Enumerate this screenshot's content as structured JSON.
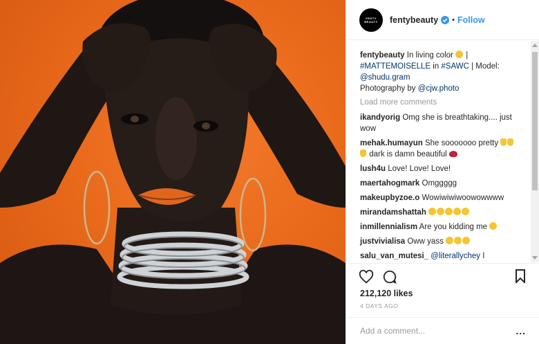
{
  "post": {
    "brand_logo_text": "FENTY BEAUTY",
    "username": "fentybeauty",
    "follow_label": "Follow",
    "caption": {
      "username": "fentybeauty",
      "text_1": "In living color",
      "text_2": "|",
      "hashtag_1": "#MATTEMOISELLE",
      "text_3": "in",
      "hashtag_2": "#SAWC",
      "text_4": "| Model:",
      "mention_model": "@shudu.gram",
      "text_5": "Photography by",
      "mention_photo": "@cjw.photo"
    },
    "load_more": "Load more comments",
    "comments": [
      {
        "user": "ikandyorig",
        "text": "Omg she is breathtaking.... just wow"
      },
      {
        "user": "mehak.humayun",
        "text": "She sooooooo pretty",
        "text2": "dark is damn beautiful"
      },
      {
        "user": "lush4u",
        "text": "Love! Love! Love!"
      },
      {
        "user": "maertahogmark",
        "text": "Omggggg"
      },
      {
        "user": "makeupbyzoe.o",
        "text": "Wowiwiwiwoowowwww"
      },
      {
        "user": "mirandamshattah",
        "text": ""
      },
      {
        "user": "inmillennialism",
        "text": "Are you kidding me"
      },
      {
        "user": "justvivialisa",
        "text": "Oww yass"
      },
      {
        "user": "salu_van_mutesi_",
        "mention": "@literallychey",
        "text": "I understand you but she's a really person"
      }
    ],
    "likes": "212,120 likes",
    "date": "4 DAYS AGO",
    "add_comment_placeholder": "Add a comment...",
    "more_label": "..."
  },
  "icons": {
    "verified": "verified-badge-icon",
    "like": "heart-icon",
    "comment": "comment-bubble-icon",
    "save": "bookmark-icon",
    "more": "more-options-icon"
  },
  "colors": {
    "link": "#003569",
    "follow": "#3897f0",
    "background_orange": "#ea6a1c"
  }
}
